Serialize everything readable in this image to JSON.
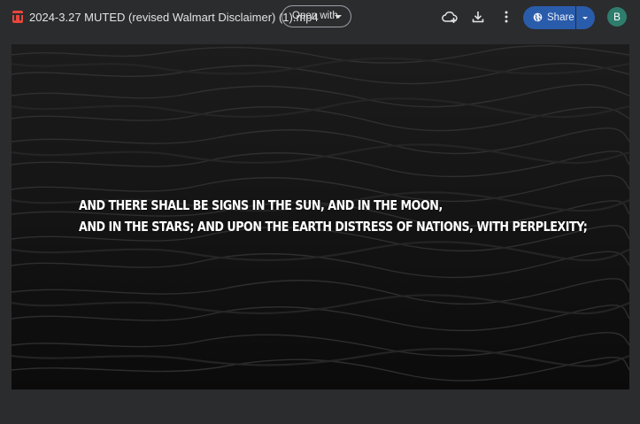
{
  "header": {
    "file_icon": "video-file-icon",
    "file_title": "2024-3.27 MUTED (revised Walmart Disclaimer) (1).mp4",
    "open_with_label": "Open with",
    "add_shortcut_icon": "add-to-drive-icon",
    "download_icon": "download-icon",
    "more_icon": "more-vertical-icon",
    "share_label": "Share",
    "share_icon": "globe-icon",
    "avatar_letter": "B"
  },
  "video": {
    "caption_line1": "AND THERE SHALL BE SIGNS IN THE SUN, AND IN THE MOON,",
    "caption_line2": "AND IN THE STARS; AND UPON THE EARTH DISTRESS OF NATIONS, WITH PERPLEXITY;"
  },
  "colors": {
    "background": "#2b2c2e",
    "share_button": "#2a5cac",
    "avatar": "#2e7d6d",
    "file_icon": "#e8453c"
  }
}
